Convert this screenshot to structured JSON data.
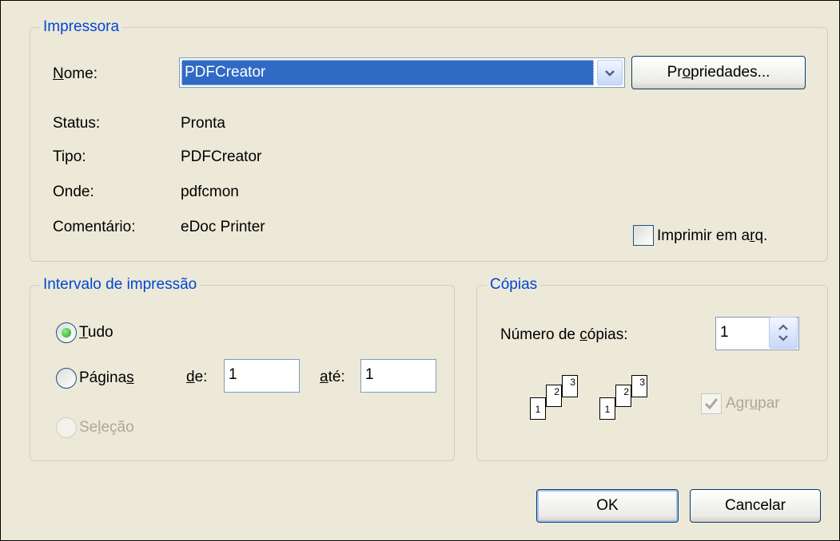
{
  "printer": {
    "group_title": "Impressora",
    "name_label_u": "N",
    "name_label_rest": "ome:",
    "name_value": "PDFCreator",
    "properties_pre": "Pr",
    "properties_u": "o",
    "properties_post": "priedades...",
    "status_label": "Status:",
    "status_value": "Pronta",
    "type_label": "Tipo:",
    "type_value": "PDFCreator",
    "where_label": "Onde:",
    "where_value": "pdfcmon",
    "comment_label": "Comentário:",
    "comment_value": "eDoc Printer",
    "print_to_file_pre": "Imprimir em a",
    "print_to_file_u": "r",
    "print_to_file_post": "q.",
    "print_to_file_checked": false
  },
  "range": {
    "group_title": "Intervalo de impressão",
    "all_u": "T",
    "all_rest": "udo",
    "all_selected": true,
    "pages_pre": "Página",
    "pages_u": "s",
    "from_u": "d",
    "from_rest": "e:",
    "from_value": "1",
    "to_u": "a",
    "to_rest": "té:",
    "to_value": "1",
    "selection_pre": "Se",
    "selection_u": "l",
    "selection_post": "eção"
  },
  "copies": {
    "group_title": "Cópias",
    "count_label_pre": "Número de ",
    "count_label_u": "c",
    "count_label_post": "ópias:",
    "count_value": "1",
    "collate_pre": "Agr",
    "collate_u": "u",
    "collate_post": "par",
    "collate_checked": true,
    "page_numbers": [
      "1",
      "2",
      "3"
    ]
  },
  "buttons": {
    "ok": "OK",
    "cancel": "Cancelar"
  },
  "colors": {
    "dialog_bg": "#ece9d8",
    "group_title": "#0046d5",
    "selection": "#316ac5"
  }
}
